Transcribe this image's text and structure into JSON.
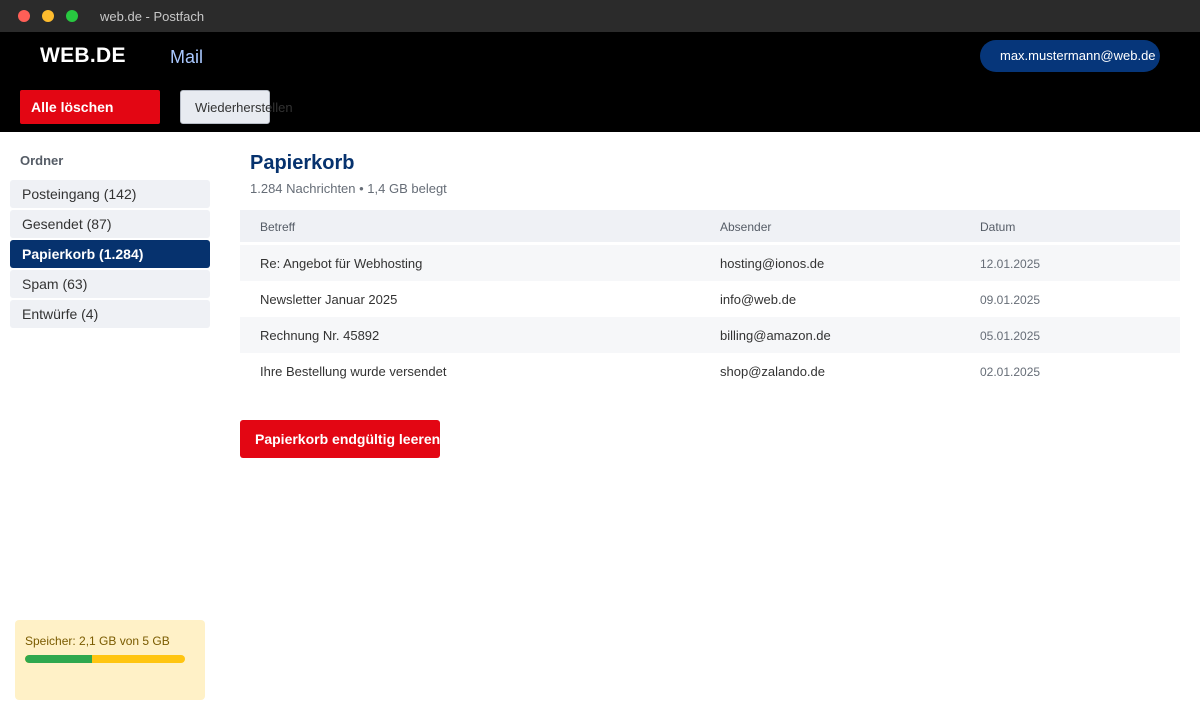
{
  "window": {
    "title": "web.de - Postfach"
  },
  "header": {
    "logo": "WEB.DE",
    "nav_mail": "Mail",
    "user_email": "max.mustermann@web.de",
    "delete_all_label": "Alle löschen",
    "restore_label": "Wiederherstellen"
  },
  "sidebar": {
    "heading": "Ordner",
    "items": [
      {
        "label": "Posteingang (142)",
        "active": false
      },
      {
        "label": "Gesendet (87)",
        "active": false
      },
      {
        "label": "Papierkorb (1.284)",
        "active": true
      },
      {
        "label": "Spam (63)",
        "active": false
      },
      {
        "label": "Entwürfe (4)",
        "active": false
      }
    ],
    "storage": {
      "label": "Speicher: 2,1 GB von 5 GB",
      "used_fraction": 0.42
    }
  },
  "main": {
    "title": "Papierkorb",
    "subtitle": "1.284 Nachrichten • 1,4 GB belegt",
    "columns": {
      "subject": "Betreff",
      "sender": "Absender",
      "date": "Datum"
    },
    "rows": [
      {
        "subject": "Re: Angebot für Webhosting",
        "sender": "hosting@ionos.de",
        "date": "12.01.2025"
      },
      {
        "subject": "Newsletter Januar 2025",
        "sender": "info@web.de",
        "date": "09.01.2025"
      },
      {
        "subject": "Rechnung Nr. 45892",
        "sender": "billing@amazon.de",
        "date": "05.01.2025"
      },
      {
        "subject": "Ihre Bestellung wurde versendet",
        "sender": "shop@zalando.de",
        "date": "02.01.2025"
      }
    ],
    "empty_trash_label": "Papierkorb endgültig leeren"
  },
  "colors": {
    "brand_red": "#e30613",
    "brand_navy": "#06326e",
    "storage_used": "#2fa84f",
    "storage_free": "#ffc511"
  }
}
